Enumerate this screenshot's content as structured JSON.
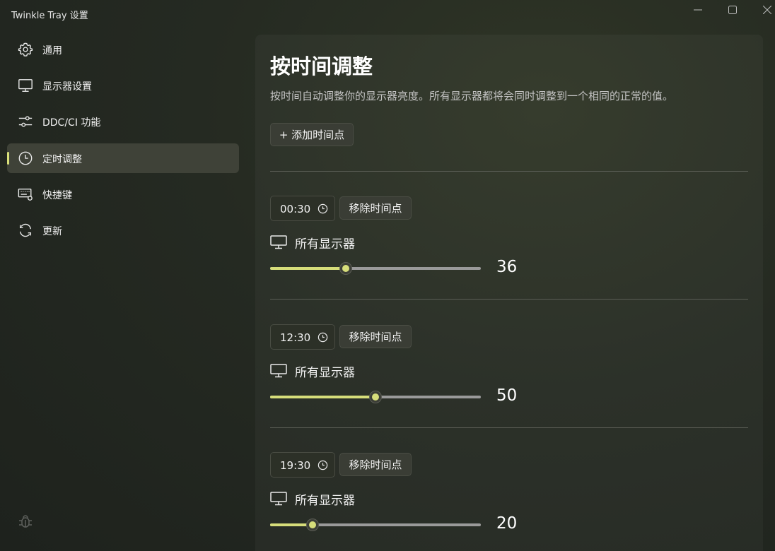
{
  "window": {
    "title": "Twinkle Tray 设置"
  },
  "sidebar": {
    "items": [
      {
        "label": "通用",
        "icon": "gear-icon"
      },
      {
        "label": "显示器设置",
        "icon": "monitor-icon"
      },
      {
        "label": "DDC/CI 功能",
        "icon": "sliders-icon"
      },
      {
        "label": "定时调整",
        "icon": "clock-icon",
        "active": true
      },
      {
        "label": "快捷键",
        "icon": "keyboard-icon"
      },
      {
        "label": "更新",
        "icon": "refresh-icon"
      }
    ]
  },
  "main": {
    "title": "按时间调整",
    "description": "按时间自动调整你的显示器亮度。所有显示器都将会同时调整到一个相同的正常的值。",
    "add_button": "+ 添加时间点",
    "remove_label": "移除时间点",
    "entries": [
      {
        "time": "00:30",
        "monitor": "所有显示器",
        "brightness": 36,
        "brightness_text": "36"
      },
      {
        "time": "12:30",
        "monitor": "所有显示器",
        "brightness": 50,
        "brightness_text": "50"
      },
      {
        "time": "19:30",
        "monitor": "所有显示器",
        "brightness": 20,
        "brightness_text": "20"
      }
    ]
  },
  "colors": {
    "accent": "#d6dd7a",
    "background": "#252a22",
    "active_item": "#3f4238"
  }
}
